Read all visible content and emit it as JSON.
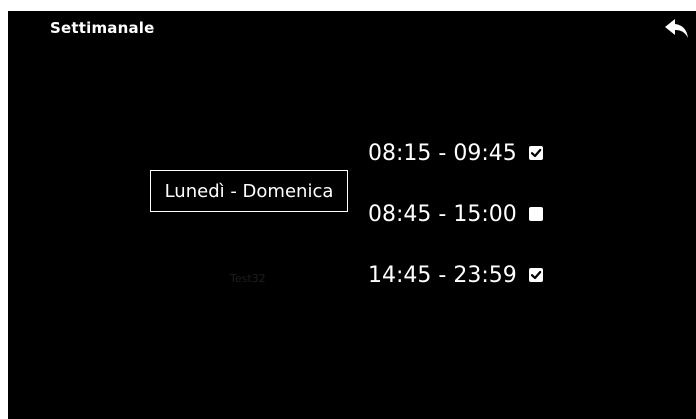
{
  "header": {
    "title": "Settimanale",
    "back_icon": "back-arrow-icon"
  },
  "schedule": {
    "day_range": "Lunedì - Domenica",
    "device_name": "Test32",
    "slots": [
      {
        "time": "08:15 - 09:45",
        "checked": true
      },
      {
        "time": "08:45 - 15:00",
        "checked": false
      },
      {
        "time": "14:45 - 23:59",
        "checked": true
      }
    ]
  },
  "colors": {
    "background": "#000000",
    "foreground": "#ffffff",
    "muted_text": "#1e1e1e"
  }
}
